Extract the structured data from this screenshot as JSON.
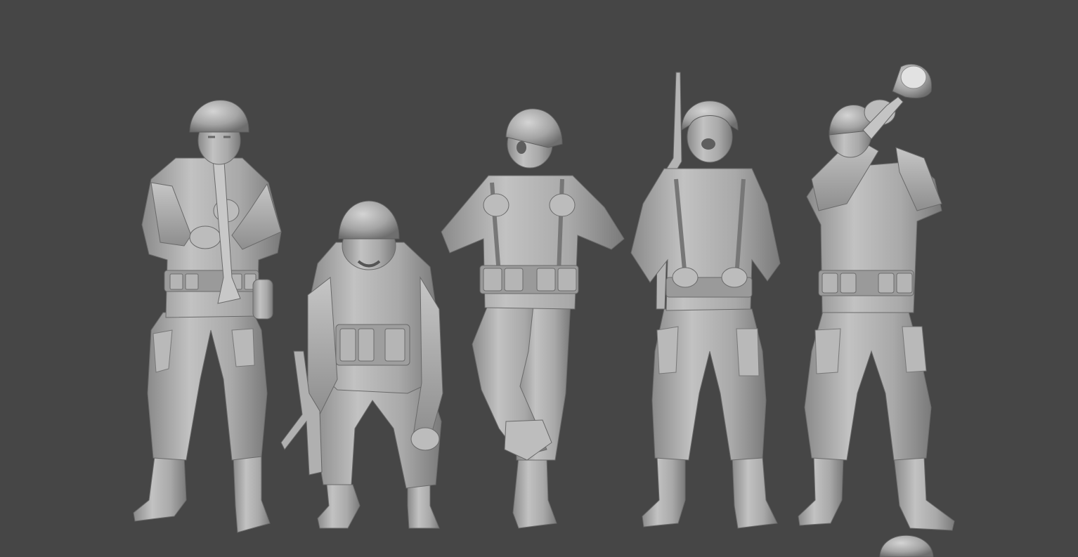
{
  "viewport": {
    "background": "#464646"
  },
  "material": {
    "base": "#a8a8a8",
    "light": "#c6c6c6",
    "shadow": "#7c7c7c",
    "dark": "#5e5e5e"
  },
  "figures": [
    {
      "pose": "standing",
      "prop": "clarinet"
    },
    {
      "pose": "crouching",
      "prop": "submachine-gun"
    },
    {
      "pose": "dancing-leg-raised",
      "prop": "none"
    },
    {
      "pose": "standing-singing",
      "prop": "rifle"
    },
    {
      "pose": "standing",
      "prop": "trumpet"
    }
  ],
  "partial_object": {
    "shape": "helmet"
  }
}
